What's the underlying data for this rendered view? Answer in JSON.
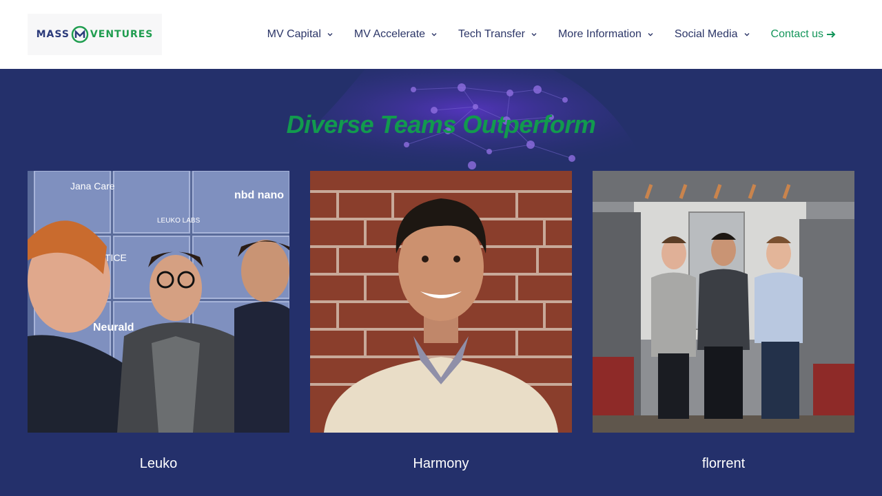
{
  "header": {
    "logo": {
      "word1": "MASS",
      "word2": "VENTURES"
    },
    "nav": [
      {
        "label": "MV Capital"
      },
      {
        "label": "MV Accelerate"
      },
      {
        "label": "Tech Transfer"
      },
      {
        "label": "More Information"
      },
      {
        "label": "Social Media"
      }
    ],
    "contact_label": "Contact us"
  },
  "main": {
    "title": "Diverse Teams Outperform",
    "cards": [
      {
        "caption": "Leuko",
        "signs": [
          "Jana Care",
          "LEUKO LABS",
          "nbd nano",
          "TICE",
          "Neurald"
        ]
      },
      {
        "caption": "Harmony"
      },
      {
        "caption": "florrent"
      }
    ]
  },
  "colors": {
    "nav_text": "#2b3567",
    "accent_green": "#129a4e",
    "background_navy": "#24306b"
  }
}
